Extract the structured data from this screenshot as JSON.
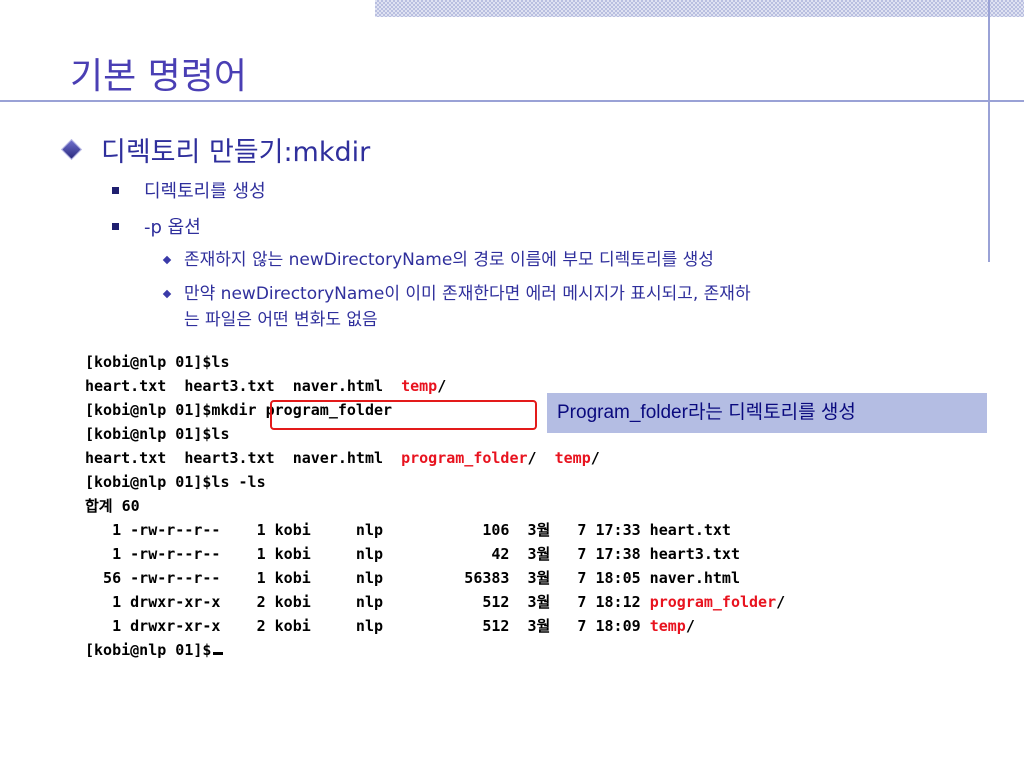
{
  "slide": {
    "title": "기본 명령어",
    "bullet1": "디렉토리 만들기:mkdir",
    "sub1": "디렉토리를 생성",
    "sub2": "-p 옵션",
    "subsub1": "존재하지 않는 newDirectoryName의 경로 이름에 부모 디렉토리를 생성",
    "subsub2_line1": "만약 newDirectoryName이 이미 존재한다면 에러 메시지가 표시되고, 존재하",
    "subsub2_line2": "는 파일은 어떤 변화도 없음"
  },
  "terminal": {
    "l1": "[kobi@nlp 01]$ls",
    "l2_a": "heart.txt  heart3.txt  naver.html  ",
    "l2_b": "temp",
    "l2_c": "/",
    "l3": "[kobi@nlp 01]$mkdir program_folder",
    "l4": "[kobi@nlp 01]$ls",
    "l5_a": "heart.txt  heart3.txt  naver.html  ",
    "l5_b": "program_folder",
    "l5_c": "/  ",
    "l5_d": "temp",
    "l5_e": "/",
    "l6": "[kobi@nlp 01]$ls -ls",
    "l7": "합계 60",
    "r1": "   1 -rw-r--r--    1 kobi     nlp           106  3월   7 17:33 heart.txt",
    "r2": "   1 -rw-r--r--    1 kobi     nlp            42  3월   7 17:38 heart3.txt",
    "r3": "  56 -rw-r--r--    1 kobi     nlp         56383  3월   7 18:05 naver.html",
    "r4_a": "   1 drwxr-xr-x    2 kobi     nlp           512  3월   7 18:12 ",
    "r4_b": "program_folder",
    "r4_c": "/",
    "r5_a": "   1 drwxr-xr-x    2 kobi     nlp           512  3월   7 18:09 ",
    "r5_b": "temp",
    "r5_c": "/",
    "l8": "[kobi@nlp 01]$"
  },
  "callout": {
    "text": "Program_folder라는 디렉토리를 생성"
  }
}
